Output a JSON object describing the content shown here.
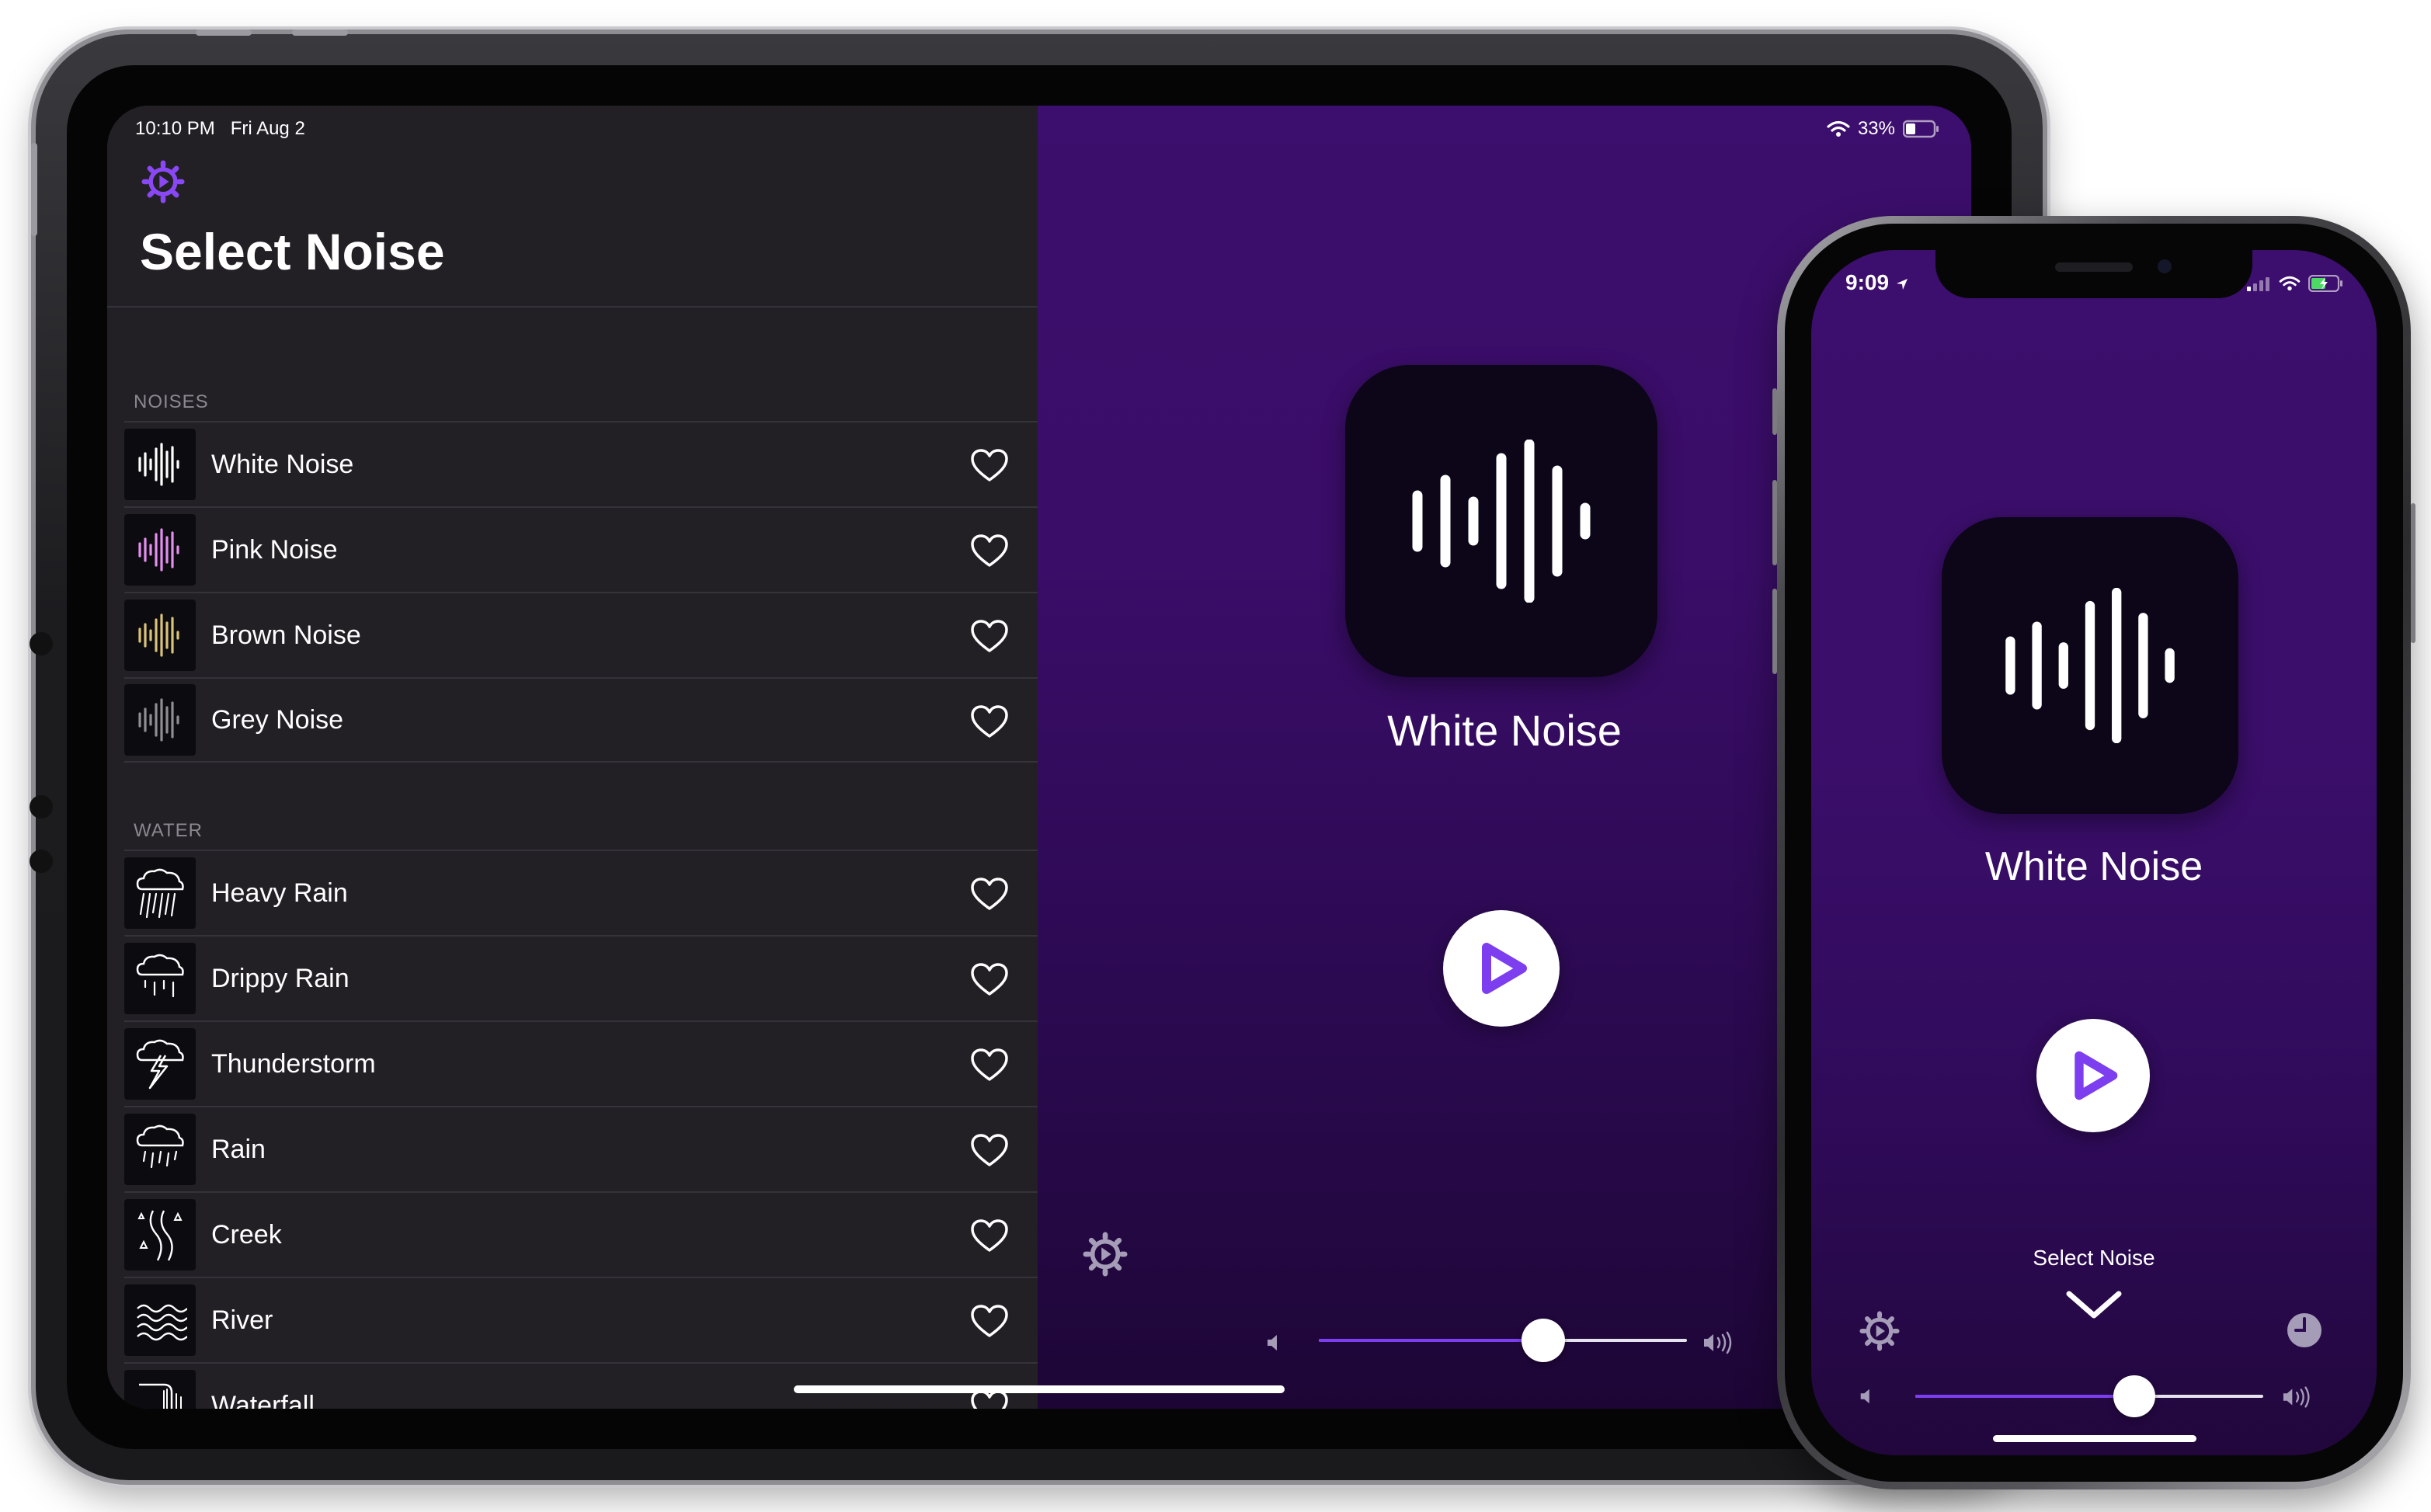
{
  "ipad": {
    "status": {
      "time": "10:10 PM",
      "date": "Fri Aug 2",
      "battery": "33%"
    },
    "sidebar": {
      "title": "Select Noise",
      "sections": [
        {
          "header": "NOISES",
          "items": [
            {
              "label": "White Noise",
              "icon": "waveform-white-icon",
              "color": "#ffffff"
            },
            {
              "label": "Pink Noise",
              "icon": "waveform-pink-icon",
              "color": "#e48ef0"
            },
            {
              "label": "Brown Noise",
              "icon": "waveform-brown-icon",
              "color": "#d9c27a"
            },
            {
              "label": "Grey Noise",
              "icon": "waveform-grey-icon",
              "color": "#8f8f93"
            }
          ]
        },
        {
          "header": "WATER",
          "items": [
            {
              "label": "Heavy Rain",
              "icon": "heavy-rain-icon"
            },
            {
              "label": "Drippy Rain",
              "icon": "drippy-rain-icon"
            },
            {
              "label": "Thunderstorm",
              "icon": "thunderstorm-icon"
            },
            {
              "label": "Rain",
              "icon": "rain-icon"
            },
            {
              "label": "Creek",
              "icon": "creek-icon"
            },
            {
              "label": "River",
              "icon": "river-icon"
            },
            {
              "label": "Waterfall",
              "icon": "waterfall-icon"
            }
          ]
        }
      ]
    },
    "player": {
      "title": "White Noise",
      "volume": 0.61
    }
  },
  "iphone": {
    "status": {
      "time": "9:09"
    },
    "player": {
      "title": "White Noise",
      "select_label": "Select Noise",
      "volume": 0.63
    }
  },
  "colors": {
    "accent": "#7d3ef0",
    "player_bg_top": "#3c0e6d",
    "sidebar_bg": "#222025"
  }
}
